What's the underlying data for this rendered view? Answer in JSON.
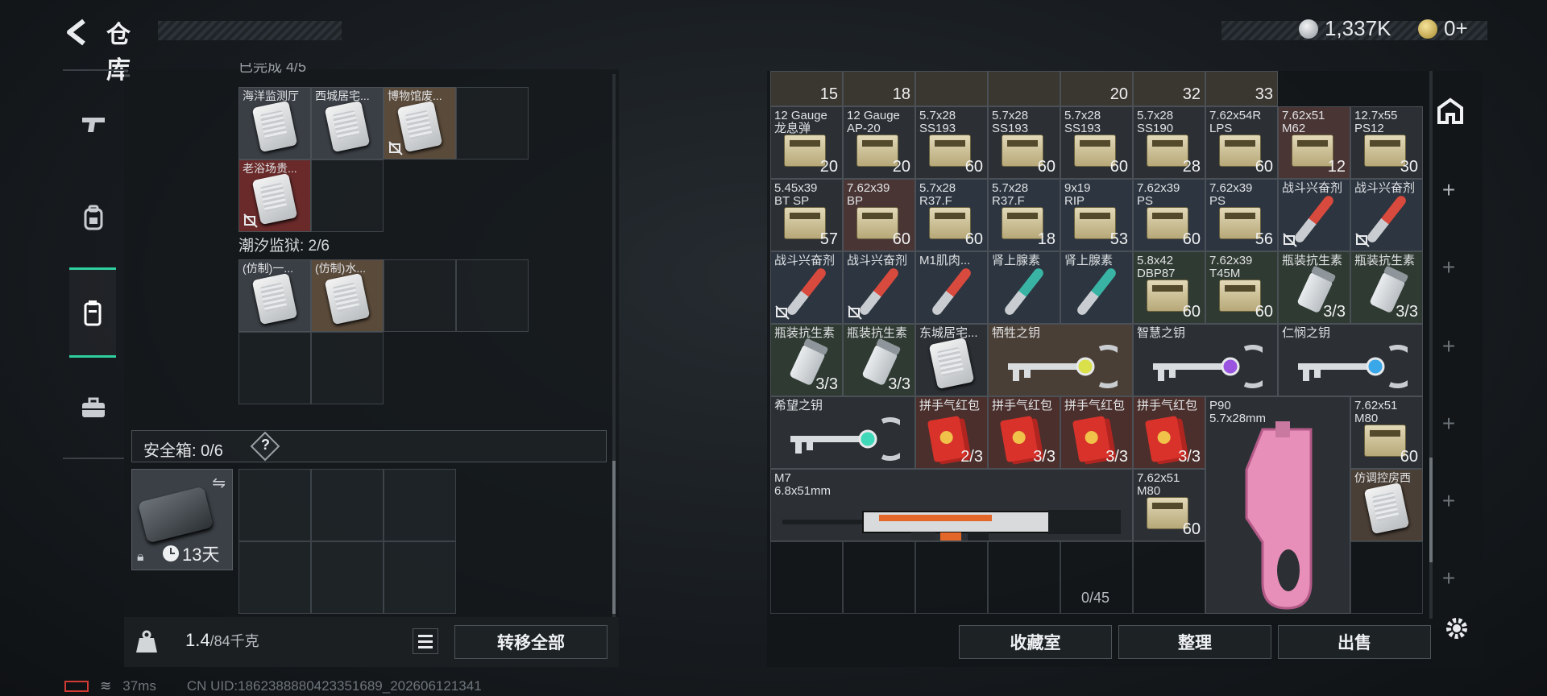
{
  "header": {
    "title": "仓库",
    "currency_silver": "1,337K",
    "currency_gold": "0+"
  },
  "left_tabs": [
    "weapon-tab",
    "backpack-tab",
    "container-tab",
    "case-tab"
  ],
  "container": {
    "partial_header": "已完成 4/5",
    "items_row1": [
      {
        "label": "海洋监测厅",
        "bg": "#3a3f45"
      },
      {
        "label": "西城居宅...",
        "bg": "#3a3f45"
      },
      {
        "label": "博物馆废...",
        "bg": "#5a4a3a",
        "nosell": true
      }
    ],
    "items_row2": [
      {
        "label": "老浴场贵...",
        "bg": "#6a2a2a",
        "nosell": true
      }
    ],
    "section2_title": "潮汐监狱: 2/6",
    "items_s2": [
      {
        "label": "(仿制)一...",
        "bg": "#3a3f45"
      },
      {
        "label": "(仿制)水...",
        "bg": "#5a4a3a"
      }
    ]
  },
  "safe_box": {
    "label": "安全箱: 0/6",
    "help": "?",
    "days": "13天"
  },
  "bottom_left": {
    "weight": "1.4",
    "weight_cap": "/84千克",
    "transfer_all": "转移全部"
  },
  "warehouse": {
    "top_partial_counts": [
      "15",
      "18",
      "",
      "",
      "20",
      "32",
      "33"
    ],
    "rows": [
      [
        {
          "l1": "12 Gauge",
          "l2": "龙息弹",
          "count": "20",
          "type": "ammo",
          "bg": "#2c3035"
        },
        {
          "l1": "12 Gauge",
          "l2": "AP-20",
          "count": "20",
          "type": "ammo",
          "bg": "#2c3035"
        },
        {
          "l1": "5.7x28",
          "l2": "SS193",
          "count": "60",
          "type": "ammo",
          "bg": "#2c3035"
        },
        {
          "l1": "5.7x28",
          "l2": "SS193",
          "count": "60",
          "type": "ammo",
          "bg": "#2c3035"
        },
        {
          "l1": "5.7x28",
          "l2": "SS193",
          "count": "60",
          "type": "ammo",
          "bg": "#2c3035"
        },
        {
          "l1": "5.7x28",
          "l2": "SS190",
          "count": "28",
          "type": "ammo",
          "bg": "#2c3035"
        },
        {
          "l1": "7.62x54R",
          "l2": "LPS",
          "count": "60",
          "type": "ammo",
          "bg": "#2c3035"
        },
        {
          "l1": "7.62x51",
          "l2": "M62",
          "count": "12",
          "type": "ammo",
          "bg": "#4a3535"
        },
        {
          "l1": "12.7x55",
          "l2": "PS12",
          "count": "30",
          "type": "ammo",
          "bg": "#2c3035"
        }
      ],
      [
        {
          "l1": "5.45x39",
          "l2": "BT SP",
          "count": "57",
          "type": "ammo",
          "bg": "#2c3035"
        },
        {
          "l1": "7.62x39",
          "l2": "BP",
          "count": "60",
          "type": "ammo",
          "bg": "#4a3535"
        },
        {
          "l1": "5.7x28",
          "l2": "R37.F",
          "count": "60",
          "type": "ammo",
          "bg": "#2c3540"
        },
        {
          "l1": "5.7x28",
          "l2": "R37.F",
          "count": "18",
          "type": "ammo",
          "bg": "#2c3540"
        },
        {
          "l1": "9x19",
          "l2": "RIP",
          "count": "53",
          "type": "ammo",
          "bg": "#2c3540"
        },
        {
          "l1": "7.62x39",
          "l2": "PS",
          "count": "60",
          "type": "ammo",
          "bg": "#2c3540"
        },
        {
          "l1": "7.62x39",
          "l2": "PS",
          "count": "56",
          "type": "ammo",
          "bg": "#2c3540"
        },
        {
          "l1": "战斗兴奋剂",
          "l2": "",
          "count": "",
          "type": "syringe",
          "bg": "#2c3540",
          "nosell": true
        },
        {
          "l1": "战斗兴奋剂",
          "l2": "",
          "count": "",
          "type": "syringe",
          "bg": "#2c3540",
          "nosell": true
        }
      ],
      [
        {
          "l1": "战斗兴奋剂",
          "l2": "",
          "count": "",
          "type": "syringe",
          "bg": "#2c3540",
          "nosell": true
        },
        {
          "l1": "战斗兴奋剂",
          "l2": "",
          "count": "",
          "type": "syringe",
          "bg": "#2c3540",
          "nosell": true
        },
        {
          "l1": "M1肌肉...",
          "l2": "",
          "count": "",
          "type": "syringe",
          "bg": "#2c3540"
        },
        {
          "l1": "肾上腺素",
          "l2": "",
          "count": "",
          "type": "syringe-teal",
          "bg": "#2c3540"
        },
        {
          "l1": "肾上腺素",
          "l2": "",
          "count": "",
          "type": "syringe-teal",
          "bg": "#2c3540"
        },
        {
          "l1": "5.8x42",
          "l2": "DBP87",
          "count": "60",
          "type": "ammo",
          "bg": "#2f3a32"
        },
        {
          "l1": "7.62x39",
          "l2": "T45M",
          "count": "60",
          "type": "ammo",
          "bg": "#2f3a32"
        },
        {
          "l1": "瓶装抗生素",
          "l2": "",
          "count": "3/3",
          "type": "bottle",
          "bg": "#2f3a32"
        },
        {
          "l1": "瓶装抗生素",
          "l2": "",
          "count": "3/3",
          "type": "bottle",
          "bg": "#2f3a32"
        }
      ]
    ],
    "row4": [
      {
        "l1": "瓶装抗生素",
        "count": "3/3",
        "type": "bottle",
        "bg": "#2f3a32"
      },
      {
        "l1": "瓶装抗生素",
        "count": "3/3",
        "type": "bottle",
        "bg": "#2f3a32"
      },
      {
        "l1": "东城居宅...",
        "count": "",
        "type": "card",
        "bg": "#2c3035"
      }
    ],
    "keys": [
      {
        "label": "牺牲之钥",
        "gem": "#d9e04a",
        "bg": "#4a3f36"
      },
      {
        "label": "智慧之钥",
        "gem": "#9a54e0",
        "bg": "#2c3035"
      },
      {
        "label": "仁悯之钥",
        "gem": "#3aa8e8",
        "bg": "#2c3035"
      }
    ],
    "row5_key": {
      "label": "希望之钥",
      "gem": "#3fd8b8",
      "bg": "#2c3035"
    },
    "red_envelopes": [
      {
        "label": "拼手气红包",
        "count": "2/3"
      },
      {
        "label": "拼手气红包",
        "count": "3/3"
      },
      {
        "label": "拼手气红包",
        "count": "3/3"
      },
      {
        "label": "拼手气红包",
        "count": "3/3"
      }
    ],
    "p90": {
      "name": "P90",
      "caliber": "5.7x28mm"
    },
    "m80_top": {
      "l1": "7.62x51",
      "l2": "M80",
      "count": "60"
    },
    "m7": {
      "name": "M7",
      "caliber": "6.8x51mm"
    },
    "m80_mid": {
      "l1": "7.62x51",
      "l2": "M80",
      "count": "60"
    },
    "fake_card": {
      "label": "仿调控房西"
    },
    "capacity": "0/45"
  },
  "buttons": {
    "collection": "收藏室",
    "sort": "整理",
    "sell": "出售"
  },
  "status_bar": {
    "ping": "37ms",
    "uid": "CN UID:1862388880423351689_202606121341"
  }
}
